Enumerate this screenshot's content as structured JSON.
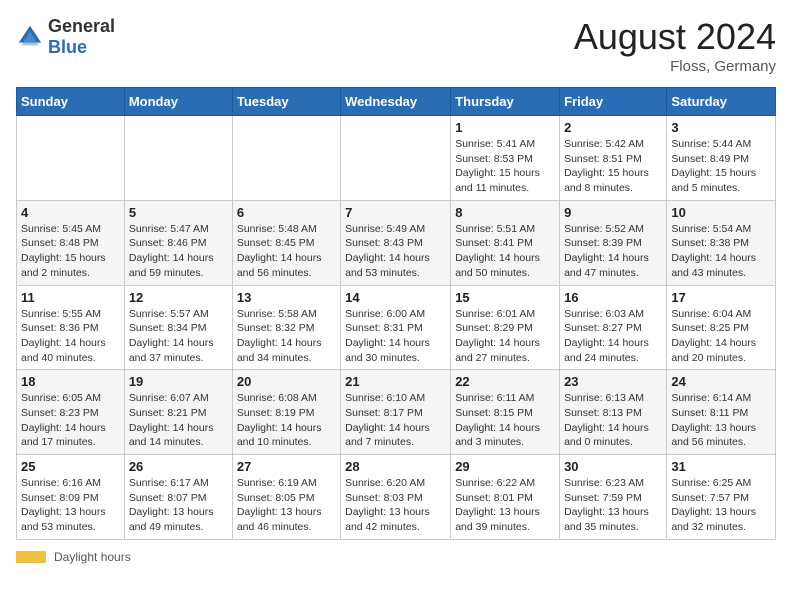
{
  "logo": {
    "general": "General",
    "blue": "Blue"
  },
  "title": {
    "month_year": "August 2024",
    "location": "Floss, Germany"
  },
  "days_of_week": [
    "Sunday",
    "Monday",
    "Tuesday",
    "Wednesday",
    "Thursday",
    "Friday",
    "Saturday"
  ],
  "weeks": [
    [
      {
        "day": "",
        "info": ""
      },
      {
        "day": "",
        "info": ""
      },
      {
        "day": "",
        "info": ""
      },
      {
        "day": "",
        "info": ""
      },
      {
        "day": "1",
        "info": "Sunrise: 5:41 AM\nSunset: 8:53 PM\nDaylight: 15 hours and 11 minutes."
      },
      {
        "day": "2",
        "info": "Sunrise: 5:42 AM\nSunset: 8:51 PM\nDaylight: 15 hours and 8 minutes."
      },
      {
        "day": "3",
        "info": "Sunrise: 5:44 AM\nSunset: 8:49 PM\nDaylight: 15 hours and 5 minutes."
      }
    ],
    [
      {
        "day": "4",
        "info": "Sunrise: 5:45 AM\nSunset: 8:48 PM\nDaylight: 15 hours and 2 minutes."
      },
      {
        "day": "5",
        "info": "Sunrise: 5:47 AM\nSunset: 8:46 PM\nDaylight: 14 hours and 59 minutes."
      },
      {
        "day": "6",
        "info": "Sunrise: 5:48 AM\nSunset: 8:45 PM\nDaylight: 14 hours and 56 minutes."
      },
      {
        "day": "7",
        "info": "Sunrise: 5:49 AM\nSunset: 8:43 PM\nDaylight: 14 hours and 53 minutes."
      },
      {
        "day": "8",
        "info": "Sunrise: 5:51 AM\nSunset: 8:41 PM\nDaylight: 14 hours and 50 minutes."
      },
      {
        "day": "9",
        "info": "Sunrise: 5:52 AM\nSunset: 8:39 PM\nDaylight: 14 hours and 47 minutes."
      },
      {
        "day": "10",
        "info": "Sunrise: 5:54 AM\nSunset: 8:38 PM\nDaylight: 14 hours and 43 minutes."
      }
    ],
    [
      {
        "day": "11",
        "info": "Sunrise: 5:55 AM\nSunset: 8:36 PM\nDaylight: 14 hours and 40 minutes."
      },
      {
        "day": "12",
        "info": "Sunrise: 5:57 AM\nSunset: 8:34 PM\nDaylight: 14 hours and 37 minutes."
      },
      {
        "day": "13",
        "info": "Sunrise: 5:58 AM\nSunset: 8:32 PM\nDaylight: 14 hours and 34 minutes."
      },
      {
        "day": "14",
        "info": "Sunrise: 6:00 AM\nSunset: 8:31 PM\nDaylight: 14 hours and 30 minutes."
      },
      {
        "day": "15",
        "info": "Sunrise: 6:01 AM\nSunset: 8:29 PM\nDaylight: 14 hours and 27 minutes."
      },
      {
        "day": "16",
        "info": "Sunrise: 6:03 AM\nSunset: 8:27 PM\nDaylight: 14 hours and 24 minutes."
      },
      {
        "day": "17",
        "info": "Sunrise: 6:04 AM\nSunset: 8:25 PM\nDaylight: 14 hours and 20 minutes."
      }
    ],
    [
      {
        "day": "18",
        "info": "Sunrise: 6:05 AM\nSunset: 8:23 PM\nDaylight: 14 hours and 17 minutes."
      },
      {
        "day": "19",
        "info": "Sunrise: 6:07 AM\nSunset: 8:21 PM\nDaylight: 14 hours and 14 minutes."
      },
      {
        "day": "20",
        "info": "Sunrise: 6:08 AM\nSunset: 8:19 PM\nDaylight: 14 hours and 10 minutes."
      },
      {
        "day": "21",
        "info": "Sunrise: 6:10 AM\nSunset: 8:17 PM\nDaylight: 14 hours and 7 minutes."
      },
      {
        "day": "22",
        "info": "Sunrise: 6:11 AM\nSunset: 8:15 PM\nDaylight: 14 hours and 3 minutes."
      },
      {
        "day": "23",
        "info": "Sunrise: 6:13 AM\nSunset: 8:13 PM\nDaylight: 14 hours and 0 minutes."
      },
      {
        "day": "24",
        "info": "Sunrise: 6:14 AM\nSunset: 8:11 PM\nDaylight: 13 hours and 56 minutes."
      }
    ],
    [
      {
        "day": "25",
        "info": "Sunrise: 6:16 AM\nSunset: 8:09 PM\nDaylight: 13 hours and 53 minutes."
      },
      {
        "day": "26",
        "info": "Sunrise: 6:17 AM\nSunset: 8:07 PM\nDaylight: 13 hours and 49 minutes."
      },
      {
        "day": "27",
        "info": "Sunrise: 6:19 AM\nSunset: 8:05 PM\nDaylight: 13 hours and 46 minutes."
      },
      {
        "day": "28",
        "info": "Sunrise: 6:20 AM\nSunset: 8:03 PM\nDaylight: 13 hours and 42 minutes."
      },
      {
        "day": "29",
        "info": "Sunrise: 6:22 AM\nSunset: 8:01 PM\nDaylight: 13 hours and 39 minutes."
      },
      {
        "day": "30",
        "info": "Sunrise: 6:23 AM\nSunset: 7:59 PM\nDaylight: 13 hours and 35 minutes."
      },
      {
        "day": "31",
        "info": "Sunrise: 6:25 AM\nSunset: 7:57 PM\nDaylight: 13 hours and 32 minutes."
      }
    ]
  ],
  "footer": {
    "daylight_label": "Daylight hours"
  }
}
